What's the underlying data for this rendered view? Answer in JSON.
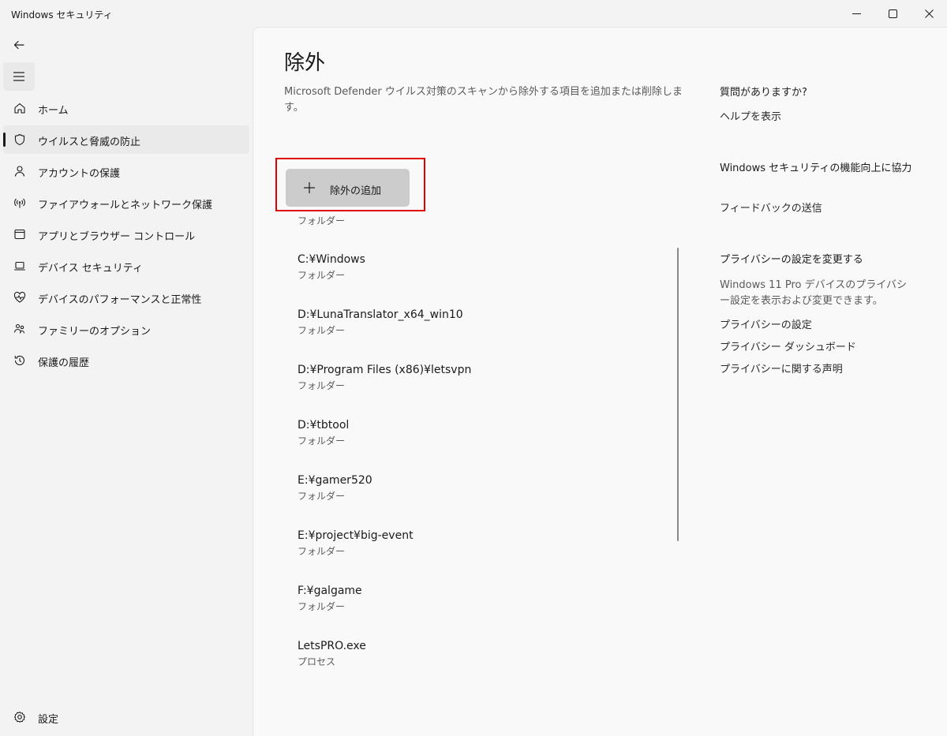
{
  "window": {
    "title": "Windows セキュリティ"
  },
  "sidebar": {
    "items": [
      {
        "label": "ホーム",
        "icon": "home-icon"
      },
      {
        "label": "ウイルスと脅威の防止",
        "icon": "shield-icon",
        "selected": true
      },
      {
        "label": "アカウントの保護",
        "icon": "person-icon"
      },
      {
        "label": "ファイアウォールとネットワーク保護",
        "icon": "wifi-signal-icon"
      },
      {
        "label": "アプリとブラウザー コントロール",
        "icon": "app-window-icon"
      },
      {
        "label": "デバイス セキュリティ",
        "icon": "laptop-icon"
      },
      {
        "label": "デバイスのパフォーマンスと正常性",
        "icon": "heart-pulse-icon"
      },
      {
        "label": "ファミリーのオプション",
        "icon": "family-icon"
      },
      {
        "label": "保護の履歴",
        "icon": "history-icon"
      }
    ],
    "settings_label": "設定"
  },
  "main": {
    "title": "除外",
    "description": "Microsoft Defender ウイルス対策のスキャンから除外する項目を追加または削除します。",
    "add_button_label": "除外の追加",
    "partial_item_type": "フォルダー",
    "exclusions": [
      {
        "path": "C:¥Windows",
        "type": "フォルダー"
      },
      {
        "path": "D:¥LunaTranslator_x64_win10",
        "type": "フォルダー"
      },
      {
        "path": "D:¥Program Files (x86)¥letsvpn",
        "type": "フォルダー"
      },
      {
        "path": "D:¥tbtool",
        "type": "フォルダー"
      },
      {
        "path": "E:¥gamer520",
        "type": "フォルダー"
      },
      {
        "path": "E:¥project¥big-event",
        "type": "フォルダー"
      },
      {
        "path": "F:¥galgame",
        "type": "フォルダー"
      },
      {
        "path": "LetsPRO.exe",
        "type": "プロセス"
      }
    ]
  },
  "right": {
    "help_heading": "質問がありますか?",
    "help_link": "ヘルプを表示",
    "feedback_heading": "Windows セキュリティの機能向上に協力",
    "feedback_link": "フィードバックの送信",
    "privacy_heading": "プライバシーの設定を変更する",
    "privacy_text": "Windows 11 Pro デバイスのプライバシー設定を表示および変更できます。",
    "privacy_links": [
      "プライバシーの設定",
      "プライバシー ダッシュボード",
      "プライバシーに関する声明"
    ]
  },
  "colors": {
    "highlight_border": "#e00000",
    "add_button_bg": "#cccccc"
  }
}
